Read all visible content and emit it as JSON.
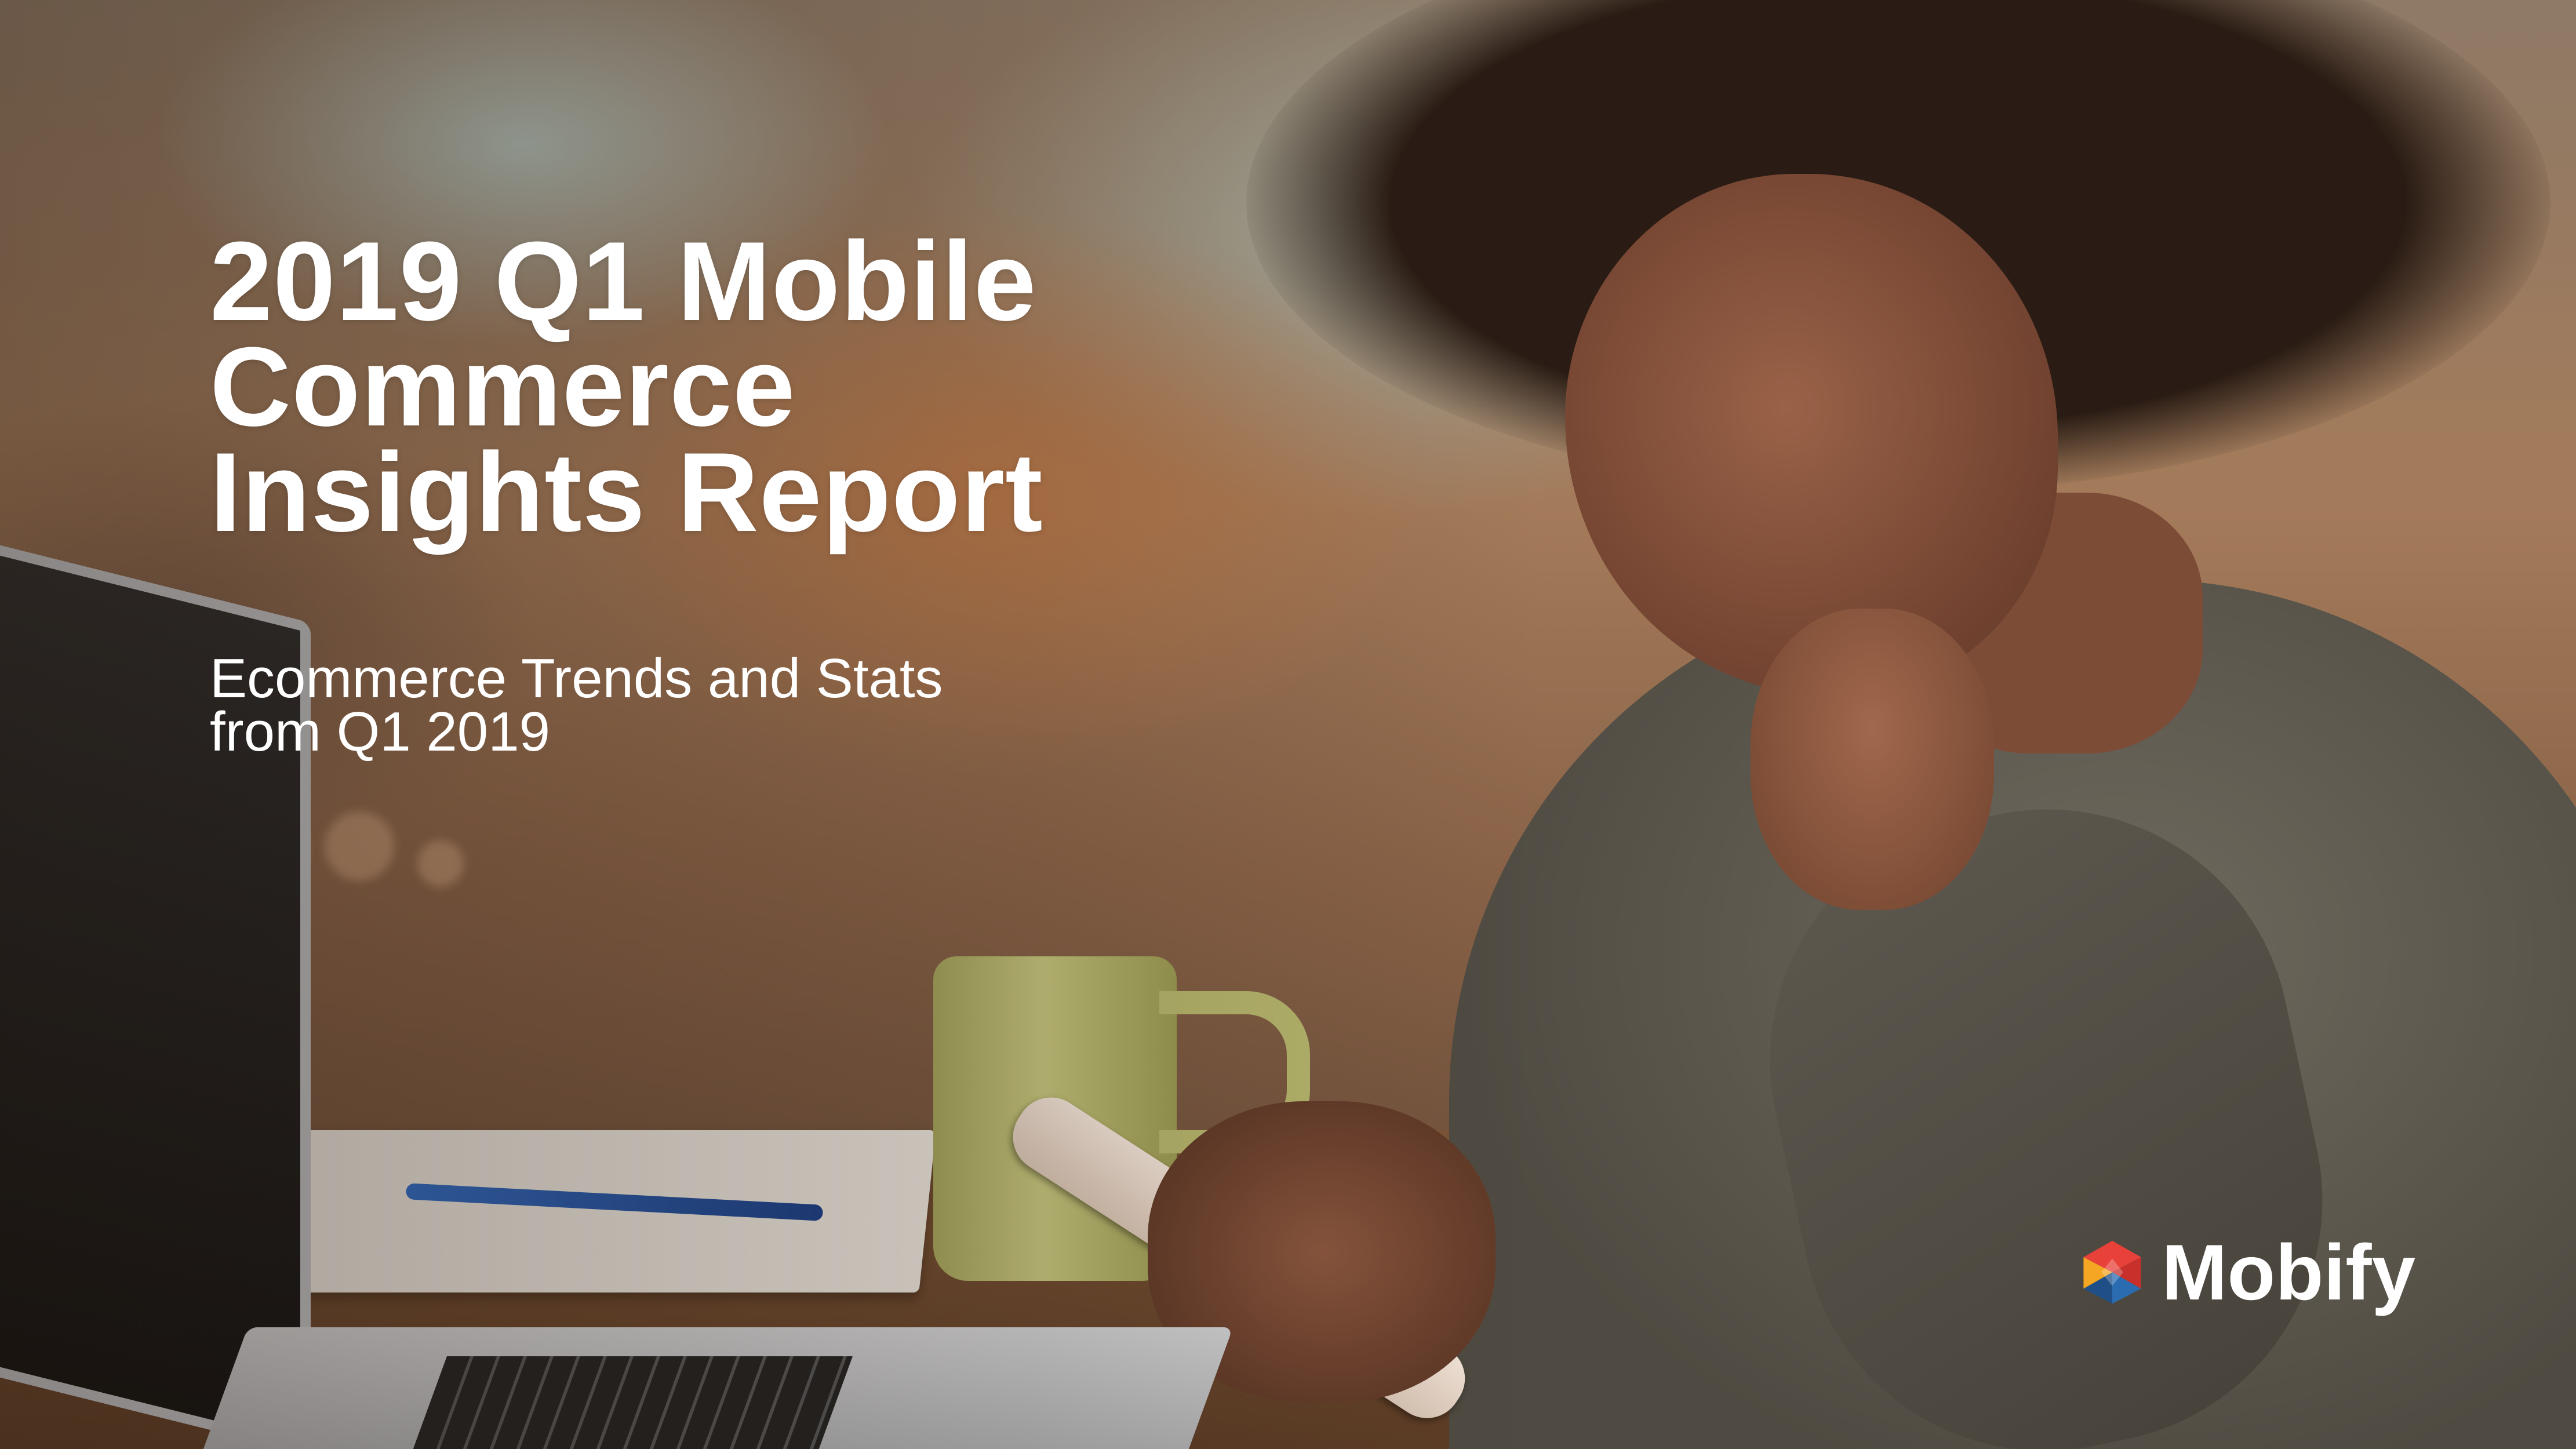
{
  "cover": {
    "title_lines": [
      "2019 Q1 Mobile",
      "Commerce",
      "Insights Report"
    ],
    "subtitle_lines": [
      "Ecommerce Trends and Stats",
      "from Q1 2019"
    ]
  },
  "brand": {
    "name": "Mobify",
    "logo_icon": "mobify-logo-icon",
    "colors": [
      "#e8413a",
      "#2b6cb0",
      "#f5a623"
    ]
  }
}
